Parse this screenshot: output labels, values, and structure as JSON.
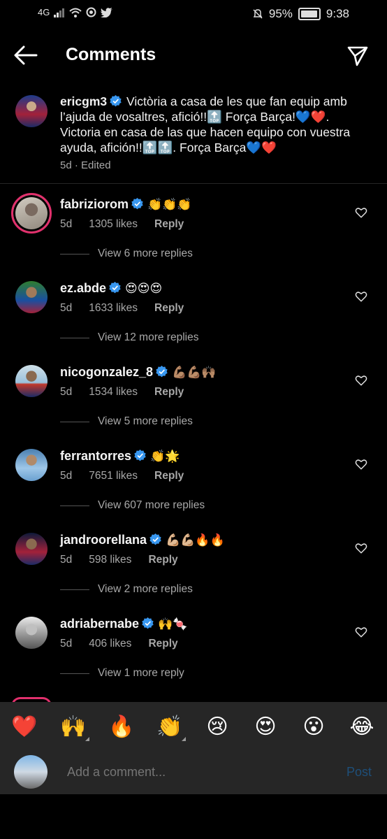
{
  "status_bar": {
    "network": "4G",
    "battery": "95%",
    "time": "9:38"
  },
  "header": {
    "title": "Comments"
  },
  "caption": {
    "username": "ericgm3",
    "text": "Victòria a casa de les que fan equip amb l’ajuda de vosaltres, afició!!🔝 Força Barça!💙❤️. Victoria en casa de las que hacen equipo con vuestra ayuda, afición!!🔝🔝. Força Barça💙❤️",
    "meta": "5d · Edited"
  },
  "comments": [
    {
      "username": "fabriziorom",
      "emoji": "👏👏👏",
      "time": "5d",
      "likes": "1305 likes",
      "reply": "Reply",
      "more": "View 6 more replies"
    },
    {
      "username": "ez.abde",
      "emoji": "😍😍😍",
      "time": "5d",
      "likes": "1633 likes",
      "reply": "Reply",
      "more": "View 12 more replies"
    },
    {
      "username": "nicogonzalez_8",
      "emoji": "💪🏽💪🏽🙌🏽",
      "time": "5d",
      "likes": "1534 likes",
      "reply": "Reply",
      "more": "View 5 more replies"
    },
    {
      "username": "ferrantorres",
      "emoji": "👏🌟",
      "time": "5d",
      "likes": "7651 likes",
      "reply": "Reply",
      "more": "View 607 more replies"
    },
    {
      "username": "jandroorellana",
      "emoji": "💪🏼💪🏼🔥🔥",
      "time": "5d",
      "likes": "598 likes",
      "reply": "Reply",
      "more": "View 2 more replies"
    },
    {
      "username": "adriabernabe",
      "emoji": "🙌🍬",
      "time": "5d",
      "likes": "406 likes",
      "reply": "Reply",
      "more": "View 1 more reply"
    }
  ],
  "emoji_bar": [
    "❤️",
    "🙌",
    "🔥",
    "👏",
    "😢",
    "😍",
    "😮",
    "😂"
  ],
  "compose": {
    "placeholder": "Add a comment...",
    "post": "Post"
  },
  "colors": {
    "verified": "#3897f0",
    "story_ring": "#e1306c",
    "post_disabled": "#1e4f7a"
  }
}
